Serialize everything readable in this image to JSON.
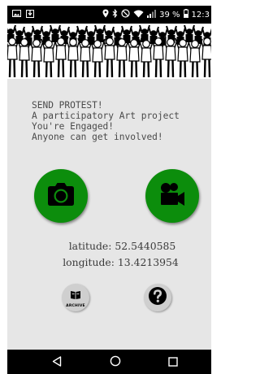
{
  "status_bar": {
    "battery_percent": "39 %",
    "time": "12:3",
    "icons": [
      "image-icon",
      "download-icon",
      "location-icon",
      "bluetooth-icon",
      "do-not-disturb-icon",
      "wifi-icon",
      "signal-icon",
      "battery-icon"
    ]
  },
  "banner": {
    "icon": "protest-crowd-illustration"
  },
  "intro": {
    "line1": "SEND PROTEST!",
    "line2": "A participatory Art project",
    "line3": "You're Engaged!",
    "line4": "Anyone can get involved!"
  },
  "actions": {
    "photo_icon": "camera-icon",
    "video_icon": "video-camera-icon"
  },
  "location": {
    "latitude_label": "latitude:",
    "latitude_value": "52.5440585",
    "longitude_label": "longitude:",
    "longitude_value": "13.4213954"
  },
  "footer_buttons": {
    "archive_label": "ARCHIVE",
    "archive_icon": "archive-book-icon",
    "help_icon": "help-icon"
  },
  "navigation": {
    "back_icon": "back-triangle-icon",
    "home_icon": "home-circle-icon",
    "recents_icon": "recents-square-icon"
  },
  "colors": {
    "accent_green": "#0c8d0c",
    "background_grey": "#e6e6e6",
    "text_grey": "#4a4a4a",
    "small_button_grey": "#cfcfcf"
  }
}
